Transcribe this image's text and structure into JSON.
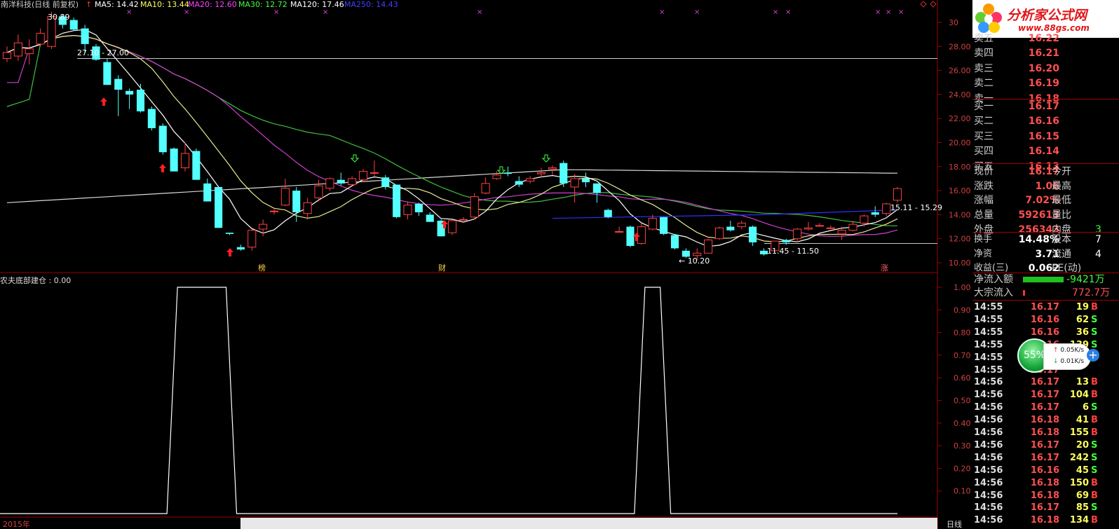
{
  "window": {
    "title": "南洋科技(日线 前复权)",
    "ma_labels": [
      {
        "text": "MA5: 14.42",
        "color": "#ffffff"
      },
      {
        "text": "MA10: 13.44",
        "color": "#ffff60"
      },
      {
        "text": "MA20: 12.60",
        "color": "#ff40ff"
      },
      {
        "text": "MA30: 12.72",
        "color": "#40ff40"
      },
      {
        "text": "MA120: 17.46",
        "color": "#ffffff"
      },
      {
        "text": "MA250: 14.43",
        "color": "#4040ff"
      }
    ]
  },
  "logo": {
    "brand": "分析家公式网",
    "url": "www.88gs.com"
  },
  "price_axis": [
    "30",
    "28.00",
    "26.00",
    "24.00",
    "22.00",
    "20.00",
    "18.00",
    "16.00",
    "14.00",
    "12.00",
    "10.00"
  ],
  "indicator_axis": [
    "1.00",
    "0.90",
    "0.80",
    "0.70",
    "0.60",
    "0.50",
    "0.40",
    "0.30",
    "0.20",
    "0.10"
  ],
  "chart_annotations": {
    "high_label": "30.89",
    "level1": "27.10 - 27.00",
    "low_label": "10.20",
    "range2": "11.45 - 11.50",
    "range3": "15.11 - 15.29",
    "marker_bang": "榜",
    "marker_cai": "财",
    "marker_zhang": "涨",
    "bottom_year": "2015年",
    "bottom_right": "日线"
  },
  "indicator": {
    "title": "农夫底部建仓 : 0.00"
  },
  "chart_data": {
    "type": "candlestick",
    "title": "南洋科技(日线 前复权)",
    "ylim": [
      9.5,
      31
    ],
    "ohlc": [
      [
        27.0,
        28.0,
        26.7,
        27.5
      ],
      [
        27.2,
        29.0,
        26.8,
        28.3
      ],
      [
        27.4,
        28.6,
        26.5,
        27.8
      ],
      [
        28.2,
        29.5,
        28.0,
        29.1
      ],
      [
        28.0,
        30.89,
        27.8,
        30.5
      ],
      [
        30.5,
        30.7,
        29.5,
        29.8
      ],
      [
        30.2,
        30.4,
        29.3,
        29.4
      ],
      [
        29.5,
        29.8,
        27.5,
        28.2
      ],
      [
        28.0,
        28.2,
        26.8,
        26.9
      ],
      [
        26.7,
        27.0,
        24.8,
        24.8
      ],
      [
        25.3,
        25.6,
        22.2,
        24.4
      ],
      [
        24.3,
        24.5,
        22.8,
        24.0
      ],
      [
        24.4,
        24.9,
        22.5,
        22.6
      ],
      [
        22.8,
        23.0,
        21.0,
        21.2
      ],
      [
        21.4,
        21.6,
        19.0,
        19.2
      ],
      [
        19.5,
        19.6,
        17.6,
        17.6
      ],
      [
        17.9,
        20.0,
        17.6,
        19.1
      ],
      [
        19.3,
        19.5,
        16.9,
        16.9
      ],
      [
        16.6,
        17.0,
        15.1,
        15.1
      ],
      [
        16.3,
        16.3,
        12.9,
        12.9
      ],
      [
        12.5,
        12.5,
        12.3,
        12.4
      ],
      [
        11.3,
        11.5,
        11.0,
        11.1
      ],
      [
        11.3,
        12.8,
        11.0,
        12.7
      ],
      [
        12.8,
        13.6,
        12.2,
        13.2
      ],
      [
        14.3,
        14.6,
        14.0,
        14.3
      ],
      [
        14.8,
        17.0,
        14.7,
        16.2
      ],
      [
        16.0,
        16.3,
        13.4,
        14.2
      ],
      [
        14.1,
        15.4,
        13.6,
        15.0
      ],
      [
        15.4,
        16.9,
        15.1,
        16.4
      ],
      [
        16.2,
        17.1,
        16.0,
        17.0
      ],
      [
        16.9,
        17.5,
        16.4,
        16.6
      ],
      [
        16.5,
        17.2,
        16.4,
        17.0
      ],
      [
        16.9,
        17.8,
        16.7,
        17.6
      ],
      [
        17.5,
        18.5,
        17.2,
        17.5
      ],
      [
        17.1,
        17.3,
        16.1,
        16.3
      ],
      [
        16.5,
        16.5,
        13.7,
        13.8
      ],
      [
        14.0,
        15.1,
        13.6,
        14.8
      ],
      [
        14.9,
        15.0,
        13.9,
        14.2
      ],
      [
        14.0,
        14.2,
        13.4,
        13.4
      ],
      [
        13.5,
        13.6,
        12.2,
        12.2
      ],
      [
        12.5,
        13.6,
        12.3,
        13.5
      ],
      [
        13.6,
        13.8,
        13.5,
        13.6
      ],
      [
        13.8,
        15.8,
        13.6,
        15.5
      ],
      [
        15.8,
        17.1,
        15.7,
        16.6
      ],
      [
        17.0,
        17.6,
        16.9,
        17.3
      ],
      [
        17.5,
        18.0,
        17.2,
        17.4
      ],
      [
        16.8,
        17.2,
        16.3,
        16.5
      ],
      [
        16.8,
        17.2,
        16.6,
        17.0
      ],
      [
        17.4,
        17.9,
        17.1,
        17.5
      ],
      [
        17.8,
        18.1,
        17.3,
        17.9
      ],
      [
        18.3,
        18.5,
        16.3,
        16.6
      ],
      [
        16.3,
        17.4,
        15.0,
        17.0
      ],
      [
        17.0,
        17.5,
        16.3,
        16.7
      ],
      [
        16.6,
        16.6,
        15.0,
        15.8
      ],
      [
        14.4,
        14.5,
        13.7,
        13.8
      ],
      [
        12.6,
        13.0,
        12.5,
        12.6
      ],
      [
        13.0,
        13.1,
        11.3,
        11.4
      ],
      [
        11.6,
        13.3,
        11.5,
        13.0
      ],
      [
        12.8,
        14.0,
        12.7,
        13.7
      ],
      [
        13.8,
        13.8,
        12.3,
        12.4
      ],
      [
        12.3,
        12.4,
        11.1,
        11.2
      ],
      [
        11.0,
        11.2,
        10.4,
        10.5
      ],
      [
        10.6,
        11.2,
        10.2,
        10.8
      ],
      [
        10.8,
        12.0,
        10.8,
        11.9
      ],
      [
        12.0,
        13.0,
        11.9,
        12.9
      ],
      [
        13.0,
        13.5,
        12.6,
        12.7
      ],
      [
        13.0,
        13.5,
        12.8,
        13.3
      ],
      [
        13.0,
        13.1,
        11.4,
        11.7
      ],
      [
        11.0,
        11.2,
        10.6,
        10.7
      ],
      [
        11.0,
        11.8,
        11.0,
        11.8
      ],
      [
        11.9,
        12.0,
        11.5,
        11.7
      ],
      [
        12.0,
        12.9,
        11.7,
        12.8
      ],
      [
        12.8,
        13.4,
        12.7,
        12.9
      ],
      [
        13.1,
        13.3,
        13.0,
        13.1
      ],
      [
        12.9,
        13.1,
        12.8,
        12.9
      ],
      [
        12.4,
        13.0,
        11.9,
        12.7
      ],
      [
        12.7,
        13.5,
        12.6,
        13.2
      ],
      [
        13.3,
        14.0,
        13.0,
        13.9
      ],
      [
        14.2,
        14.7,
        13.8,
        14.0
      ],
      [
        14.1,
        15.0,
        13.9,
        14.9
      ],
      [
        15.2,
        16.3,
        15.0,
        16.17
      ]
    ],
    "ma": {
      "MA5": 14.42,
      "MA10": 13.44,
      "MA20": 12.6,
      "MA30": 12.72,
      "MA120": 17.46,
      "MA250": 14.43
    },
    "indicator_series": {
      "name": "农夫底部建仓",
      "ylim": [
        0,
        1.1
      ],
      "values_on_at_bars": [
        [
          15,
          20
        ],
        [
          57,
          59
        ]
      ]
    }
  },
  "quote": {
    "sell": [
      {
        "label": "卖五",
        "price": "16.22"
      },
      {
        "label": "卖四",
        "price": "16.21"
      },
      {
        "label": "卖三",
        "price": "16.20"
      },
      {
        "label": "卖二",
        "price": "16.19"
      },
      {
        "label": "卖一",
        "price": "16.18"
      }
    ],
    "buy": [
      {
        "label": "买一",
        "price": "16.17"
      },
      {
        "label": "买二",
        "price": "16.16"
      },
      {
        "label": "买三",
        "price": "16.15"
      },
      {
        "label": "买四",
        "price": "16.14"
      },
      {
        "label": "买五",
        "price": "16.13"
      }
    ],
    "stats": [
      {
        "l1": "现价",
        "v1": "16.17",
        "l2": "今开",
        "v2": ""
      },
      {
        "l1": "涨跌",
        "v1": "1.06",
        "l2": "最高",
        "v2": ""
      },
      {
        "l1": "涨幅",
        "v1": "7.02%",
        "l2": "最低",
        "v2": ""
      },
      {
        "l1": "总量",
        "v1": "592613",
        "l2": "量比",
        "v2": ""
      },
      {
        "l1": "外盘",
        "v1": "256343",
        "l2": "内盘",
        "v2": "3"
      }
    ],
    "stats2": [
      {
        "l1": "换手",
        "v1": "14.48%",
        "l2": "股本",
        "v2": "7"
      },
      {
        "l1": "净资",
        "v1": "3.71",
        "l2": "流通",
        "v2": "4"
      },
      {
        "l1": "收益(三)",
        "v1": "0.062",
        "l2": "PE(动)",
        "v2": ""
      }
    ],
    "net_inflow": {
      "label": "净流入额",
      "value": "-9421万"
    },
    "block_inflow": {
      "label": "大宗流入",
      "value": "772.7万"
    },
    "ticks": [
      {
        "time": "14:55",
        "price": "16.17",
        "vol": "19",
        "dir": "B",
        "color": "#ff5050"
      },
      {
        "time": "14:55",
        "price": "16.16",
        "vol": "62",
        "dir": "S",
        "color": "#ff5050"
      },
      {
        "time": "14:55",
        "price": "16.16",
        "vol": "36",
        "dir": "S",
        "color": "#ff5050"
      },
      {
        "time": "14:55",
        "price": "16.16",
        "vol": "139",
        "dir": "S",
        "color": "#ff5050"
      },
      {
        "time": "14:55",
        "price": "16.17",
        "vol": "",
        "dir": "",
        "color": "#ff5050"
      },
      {
        "time": "14:55",
        "price": "16.17",
        "vol": "",
        "dir": "",
        "color": "#ff5050"
      },
      {
        "time": "14:56",
        "price": "16.17",
        "vol": "13",
        "dir": "B",
        "color": "#ff5050"
      },
      {
        "time": "14:56",
        "price": "16.17",
        "vol": "104",
        "dir": "B",
        "color": "#ff5050"
      },
      {
        "time": "14:56",
        "price": "16.17",
        "vol": "6",
        "dir": "S",
        "color": "#ff5050"
      },
      {
        "time": "14:56",
        "price": "16.18",
        "vol": "41",
        "dir": "B",
        "color": "#ff5050"
      },
      {
        "time": "14:56",
        "price": "16.18",
        "vol": "155",
        "dir": "B",
        "color": "#ff5050"
      },
      {
        "time": "14:56",
        "price": "16.17",
        "vol": "20",
        "dir": "S",
        "color": "#ff5050"
      },
      {
        "time": "14:56",
        "price": "16.17",
        "vol": "242",
        "dir": "S",
        "color": "#ff5050"
      },
      {
        "time": "14:56",
        "price": "16.16",
        "vol": "45",
        "dir": "S",
        "color": "#ff5050"
      },
      {
        "time": "14:56",
        "price": "16.18",
        "vol": "150",
        "dir": "B",
        "color": "#ff5050"
      },
      {
        "time": "14:56",
        "price": "16.18",
        "vol": "69",
        "dir": "B",
        "color": "#ff5050"
      },
      {
        "time": "14:56",
        "price": "16.17",
        "vol": "85",
        "dir": "S",
        "color": "#ff5050"
      },
      {
        "time": "14:56",
        "price": "16.18",
        "vol": "134",
        "dir": "B",
        "color": "#ff5050"
      }
    ]
  },
  "speed": {
    "percent": "55%",
    "up": "0.05K/s",
    "down": "0.01K/s"
  }
}
